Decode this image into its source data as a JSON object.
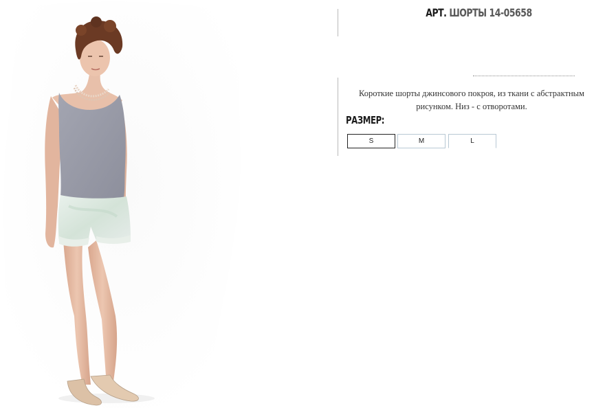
{
  "product": {
    "title_prefix": "АРТ.",
    "title_name": "ШОРТЫ 14-05658",
    "description_line1": "Короткие шорты джинсового покроя, из ткани с абстрактным",
    "description_line2": "рисунком. Низ - с отворотами.",
    "size_label": "РАЗМЕР:",
    "sizes": [
      {
        "label": "S",
        "selected": true
      },
      {
        "label": "M",
        "selected": false
      },
      {
        "label": "L",
        "selected": false
      }
    ]
  },
  "colors": {
    "top": "#9a9ca8",
    "shorts": "#dde8de",
    "skin": "#e4bba4",
    "hair": "#6b3a24",
    "shoes": "#e1c7ad",
    "divider": "#b9b9b9"
  }
}
